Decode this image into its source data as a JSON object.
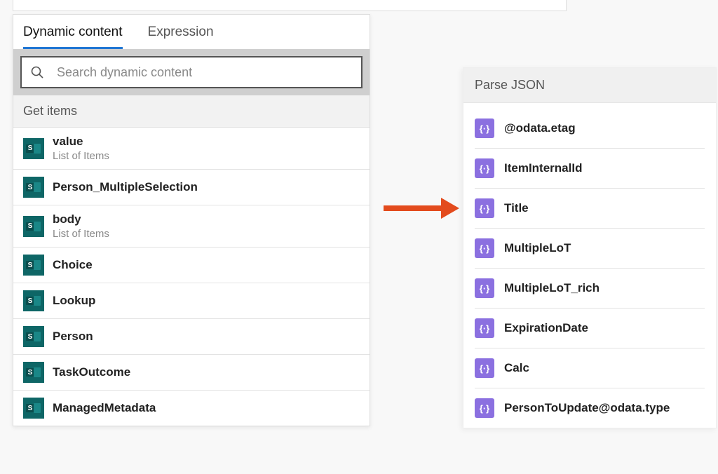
{
  "tabs": {
    "dynamic_content": "Dynamic content",
    "expression": "Expression"
  },
  "search": {
    "placeholder": "Search dynamic content"
  },
  "left": {
    "section_header": "Get items",
    "items": [
      {
        "title": "value",
        "desc": "List of Items"
      },
      {
        "title": "Person_MultipleSelection",
        "desc": ""
      },
      {
        "title": "body",
        "desc": "List of Items"
      },
      {
        "title": "Choice",
        "desc": ""
      },
      {
        "title": "Lookup",
        "desc": ""
      },
      {
        "title": "Person",
        "desc": ""
      },
      {
        "title": "TaskOutcome",
        "desc": ""
      },
      {
        "title": "ManagedMetadata",
        "desc": ""
      }
    ]
  },
  "right": {
    "header": "Parse JSON",
    "icon_glyph": "{·}",
    "items": [
      "@odata.etag",
      "ItemInternalId",
      "Title",
      "MultipleLoT",
      "MultipleLoT_rich",
      "ExpirationDate",
      "Calc",
      "PersonToUpdate@odata.type"
    ]
  },
  "colors": {
    "active_tab_underline": "#2177d4",
    "json_icon_bg": "#8b70e0",
    "sharepoint_icon_bg": "#0e6666",
    "arrow": "#e34b1d"
  }
}
